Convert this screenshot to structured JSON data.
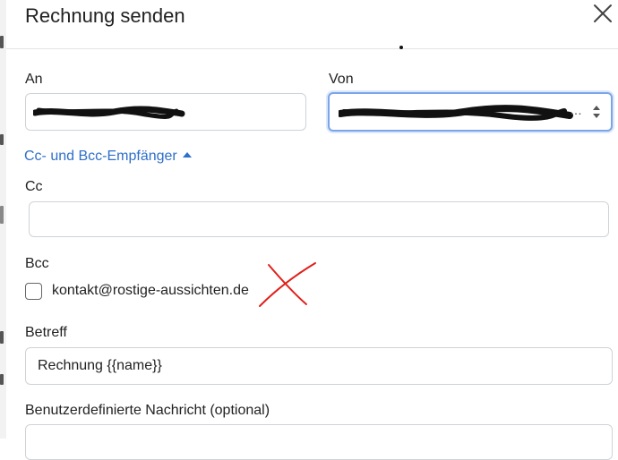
{
  "dialog": {
    "title": "Rechnung senden",
    "close_label": "×"
  },
  "form": {
    "to_label": "An",
    "to_value": "",
    "from_label": "Von",
    "from_suffix": "…",
    "cc_toggle_label": "Cc- und Bcc-Empfänger",
    "cc_label": "Cc",
    "cc_value": "",
    "bcc_label": "Bcc",
    "bcc_option_label": "kontakt@rostige-aussichten.de",
    "bcc_option_checked": false,
    "subject_label": "Betreff",
    "subject_value": "Rechnung {{name}}",
    "message_label": "Benutzerdefinierte Nachricht (optional)"
  },
  "colors": {
    "accent_link": "#2f6fc9",
    "focus_ring": "#7ba5e8",
    "annotation_red": "#e0201b"
  }
}
